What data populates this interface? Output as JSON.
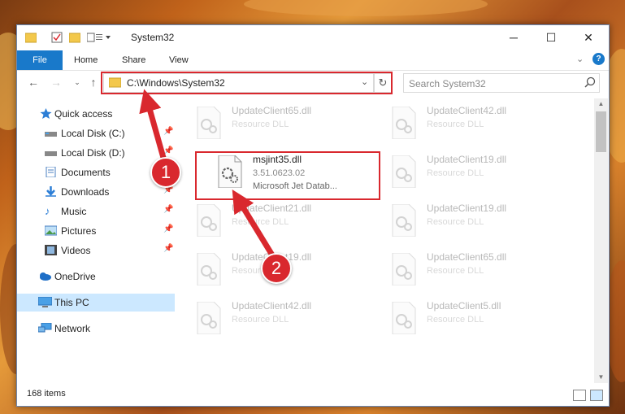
{
  "window": {
    "title": "System32"
  },
  "ribbon": {
    "tabs": [
      "File",
      "Home",
      "Share",
      "View"
    ]
  },
  "address": {
    "path": "C:\\Windows\\System32"
  },
  "search": {
    "placeholder": "Search System32"
  },
  "sidebar": {
    "items": [
      {
        "label": "Quick access",
        "icon": "star-icon",
        "pinned": false
      },
      {
        "label": "Local Disk (C:)",
        "icon": "drive-icon",
        "pinned": true
      },
      {
        "label": "Local Disk (D:)",
        "icon": "drive-icon",
        "pinned": true
      },
      {
        "label": "Documents",
        "icon": "documents-icon",
        "pinned": true
      },
      {
        "label": "Downloads",
        "icon": "download-icon",
        "pinned": true
      },
      {
        "label": "Music",
        "icon": "music-icon",
        "pinned": true
      },
      {
        "label": "Pictures",
        "icon": "pictures-icon",
        "pinned": true
      },
      {
        "label": "Videos",
        "icon": "videos-icon",
        "pinned": true
      },
      {
        "label": "OneDrive",
        "icon": "cloud-icon",
        "pinned": false
      },
      {
        "label": "This PC",
        "icon": "computer-icon",
        "pinned": false,
        "selected": true
      },
      {
        "label": "Network",
        "icon": "network-icon",
        "pinned": false
      }
    ]
  },
  "files": {
    "highlighted": {
      "name": "msjint35.dll",
      "version": "3.51.0623.02",
      "description": "Microsoft Jet Datab..."
    },
    "background": [
      {
        "name": "UpdateClient65.dll",
        "type": "Resource DLL"
      },
      {
        "name": "UpdateClient42.dll",
        "type": "Resource DLL"
      },
      {
        "name": "UpdateClient19.dll",
        "type": "Resource DLL"
      },
      {
        "name": "UpdateClient21.dll",
        "type": "Resource DLL"
      },
      {
        "name": "UpdateClient19.dll",
        "type": "Resource DLL"
      },
      {
        "name": "UpdateClient19.dll",
        "type": "Resource DLL"
      },
      {
        "name": "UpdateClient65.dll",
        "type": "Resource DLL"
      },
      {
        "name": "UpdateClient42.dll",
        "type": "Resource DLL"
      },
      {
        "name": "UpdateClient5.dll",
        "type": "Resource DLL"
      }
    ]
  },
  "status": {
    "item_count": "168 items"
  },
  "annotations": {
    "step1": "1",
    "step2": "2"
  },
  "colors": {
    "accent": "#1979ca",
    "annotation": "#d9282e",
    "selected": "#cce8ff"
  }
}
